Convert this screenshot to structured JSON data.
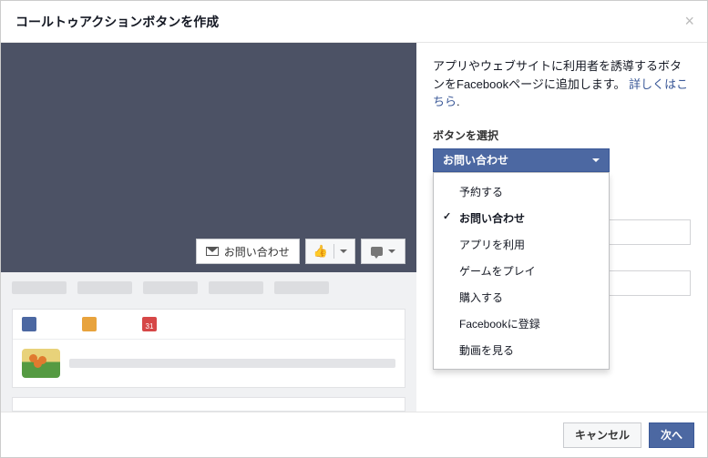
{
  "header": {
    "title": "コールトゥアクションボタンを作成"
  },
  "preview": {
    "cta_label": "お問い合わせ",
    "composer_icons": [
      "status",
      "photo",
      "event"
    ]
  },
  "right": {
    "description_prefix": "アプリやウェブサイトに利用者を誘導するボタンをFacebookページに追加します。",
    "more_link": "詳しくはこちら",
    "select_label": "ボタンを選択",
    "selected": "お問い合わせ",
    "options": [
      "予約する",
      "お問い合わせ",
      "アプリを利用",
      "ゲームをプレイ",
      "購入する",
      "Facebookに登録",
      "動画を見る"
    ]
  },
  "footer": {
    "cancel": "キャンセル",
    "next": "次へ"
  }
}
